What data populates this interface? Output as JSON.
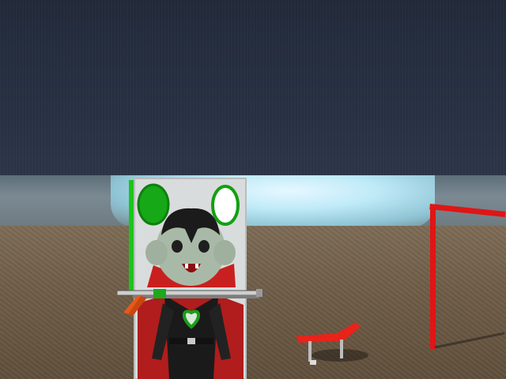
{
  "scene": {
    "sky_color": "#222a3a",
    "horizon_glow_color": "#d8f4ff",
    "ground_color": "#6f5d47",
    "board_accent_color": "#1db41d",
    "prop_color": "#e8231a"
  },
  "objects": {
    "target_board": {
      "figure": "vampire-cartoon",
      "targets_remaining": 2
    },
    "weapon": {
      "type": "blaster-rifle"
    },
    "slide_prop": {
      "type": "red-slide"
    },
    "goal_post": {
      "type": "red-frame"
    }
  }
}
